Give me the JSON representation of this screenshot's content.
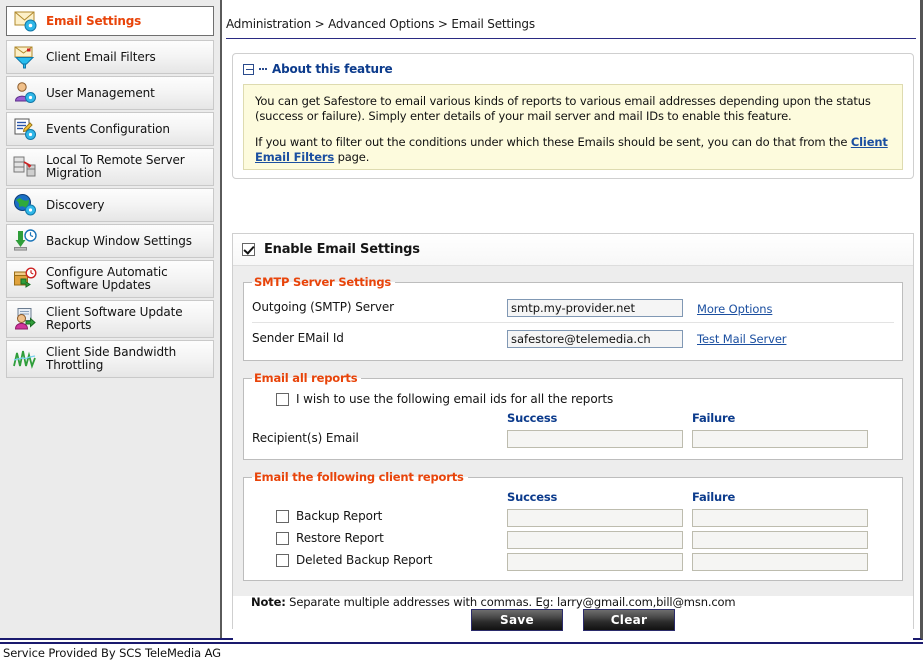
{
  "sidebar": {
    "header": {
      "label": "Email Settings",
      "icon": "mail-gear-icon"
    },
    "items": [
      {
        "label": "Client Email Filters",
        "icon": "mail-funnel-icon"
      },
      {
        "label": "User Management",
        "icon": "user-gear-icon"
      },
      {
        "label": "Events Configuration",
        "icon": "document-pencil-gear-icon"
      },
      {
        "label": "Local To Remote Server Migration",
        "icon": "server-migration-icon"
      },
      {
        "label": "Discovery",
        "icon": "globe-gear-icon"
      },
      {
        "label": "Backup Window Settings",
        "icon": "download-clock-icon"
      },
      {
        "label": "Configure Automatic Software Updates",
        "icon": "box-clock-icon"
      },
      {
        "label": "Client Software Update Reports",
        "icon": "person-report-icon"
      },
      {
        "label": "Client Side Bandwidth Throttling",
        "icon": "graph-line-icon"
      }
    ]
  },
  "breadcrumb": "Administration > Advanced Options > Email Settings",
  "about": {
    "icon": "collapse-minus-icon",
    "title": "About this feature",
    "paragraph1": "You can get Safestore to email various kinds of reports to various email addresses depending upon the status (success or failure). Simply enter details of your mail server and mail IDs to enable this feature.",
    "paragraph2_before": "If you want to filter out the conditions under which these Emails should be sent, you can do that from the ",
    "paragraph2_link": "Client Email Filters",
    "paragraph2_after": " page."
  },
  "form": {
    "enable_label": "Enable Email Settings",
    "enable_checked": true,
    "smtp": {
      "legend": "SMTP Server Settings",
      "server_label": "Outgoing (SMTP) Server",
      "server_value": "smtp.my-provider.net",
      "server_link": "More Options",
      "sender_label": "Sender EMail Id",
      "sender_value": "safestore@telemedia.ch",
      "sender_link": "Test Mail Server"
    },
    "all_reports": {
      "legend": "Email all reports",
      "checkbox_label": "I wish to use the following email ids for all the reports",
      "checkbox_checked": false,
      "col_success": "Success",
      "col_failure": "Failure",
      "recipient_label": "Recipient(s) Email",
      "recipient_success_value": "",
      "recipient_failure_value": ""
    },
    "client_reports": {
      "legend": "Email the following client reports",
      "col_success": "Success",
      "col_failure": "Failure",
      "rows": [
        {
          "label": "Backup Report",
          "checked": false,
          "success_value": "",
          "failure_value": ""
        },
        {
          "label": "Restore Report",
          "checked": false,
          "success_value": "",
          "failure_value": ""
        },
        {
          "label": "Deleted Backup Report",
          "checked": false,
          "success_value": "",
          "failure_value": ""
        }
      ]
    },
    "note_prefix": "Note:",
    "note_text": " Separate multiple addresses with commas. Eg: larry@gmail.com,bill@msn.com",
    "save_label": "Save",
    "clear_label": "Clear"
  },
  "statusbar": {
    "text": "Service Provided By SCS TeleMedia AG"
  },
  "colors": {
    "accent_orange": "#e8440a",
    "link_blue": "#1b4fa0",
    "heading_blue": "#0c3b8c",
    "about_bg": "#fdfbdd",
    "panel_bg": "#ededed",
    "statusbar_rule": "#1a1a6e"
  }
}
